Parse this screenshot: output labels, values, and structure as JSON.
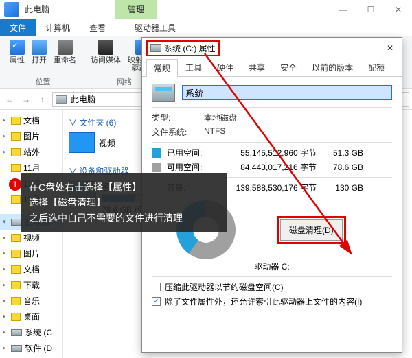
{
  "window": {
    "title": "此电脑",
    "management_tab": "管理",
    "controls": {
      "min": "—",
      "max": "☐",
      "close": "✕"
    }
  },
  "ribbon_tabs": {
    "file": "文件",
    "computer": "计算机",
    "view": "查看",
    "drive_tools": "驱动器工具"
  },
  "ribbon": {
    "properties": "属性",
    "open": "打开",
    "rename": "重命名",
    "access_media": "访问媒体",
    "map_network_drive": "映射网络\n驱动器",
    "group_location": "位置",
    "group_network": "网络"
  },
  "address": {
    "location": "此电脑"
  },
  "nav": {
    "items": [
      {
        "label": "文档",
        "icon": "folder"
      },
      {
        "label": "图片",
        "icon": "folder"
      },
      {
        "label": "站外",
        "icon": "folder"
      },
      {
        "label": "11月",
        "icon": "folder"
      },
      {
        "label": "11月",
        "icon": "folder"
      },
      {
        "label": "11月",
        "icon": "folder"
      }
    ],
    "this_pc": "此电脑",
    "pc_children": [
      {
        "label": "视频"
      },
      {
        "label": "图片"
      },
      {
        "label": "文档"
      },
      {
        "label": "下载"
      },
      {
        "label": "音乐"
      },
      {
        "label": "桌面"
      },
      {
        "label": "系统 (C"
      },
      {
        "label": "软件 (D"
      }
    ]
  },
  "content": {
    "folders_header": "文件夹 (6)",
    "folders": [
      {
        "label": "视频"
      }
    ],
    "drives_header": "设备和驱动器",
    "drive": {
      "name": "系统 (C:)",
      "free_text": "78.6 GB 可",
      "fill_pct": 40
    }
  },
  "properties_dialog": {
    "title": "系统 (C:) 属性",
    "tabs": {
      "general": "常规",
      "tools": "工具",
      "hardware": "硬件",
      "sharing": "共享",
      "security": "安全",
      "previous": "以前的版本",
      "quota": "配额"
    },
    "name_value": "系统",
    "type_label": "类型:",
    "type_value": "本地磁盘",
    "fs_label": "文件系统:",
    "fs_value": "NTFS",
    "used_label": "已用空间:",
    "used_bytes": "55,145,512,960 字节",
    "used_gb": "51.3 GB",
    "free_label": "可用空间:",
    "free_bytes": "84,443,017,216 字节",
    "free_gb": "78.6 GB",
    "capacity_label": "容量:",
    "capacity_bytes": "139,588,530,176 字节",
    "capacity_gb": "130 GB",
    "drive_label": "驱动器 C:",
    "cleanup_button": "磁盘清理(D)",
    "compress_checkbox": "压缩此驱动器以节约磁盘空间(C)",
    "index_checkbox": "除了文件属性外，还允许索引此驱动器上文件的内容(I)"
  },
  "annotation": {
    "badge": "1",
    "line1": "在C盘处右击选择【属性】",
    "line2": "选择【磁盘清理】",
    "line3": "之后选中自己不需要的文件进行清理"
  }
}
